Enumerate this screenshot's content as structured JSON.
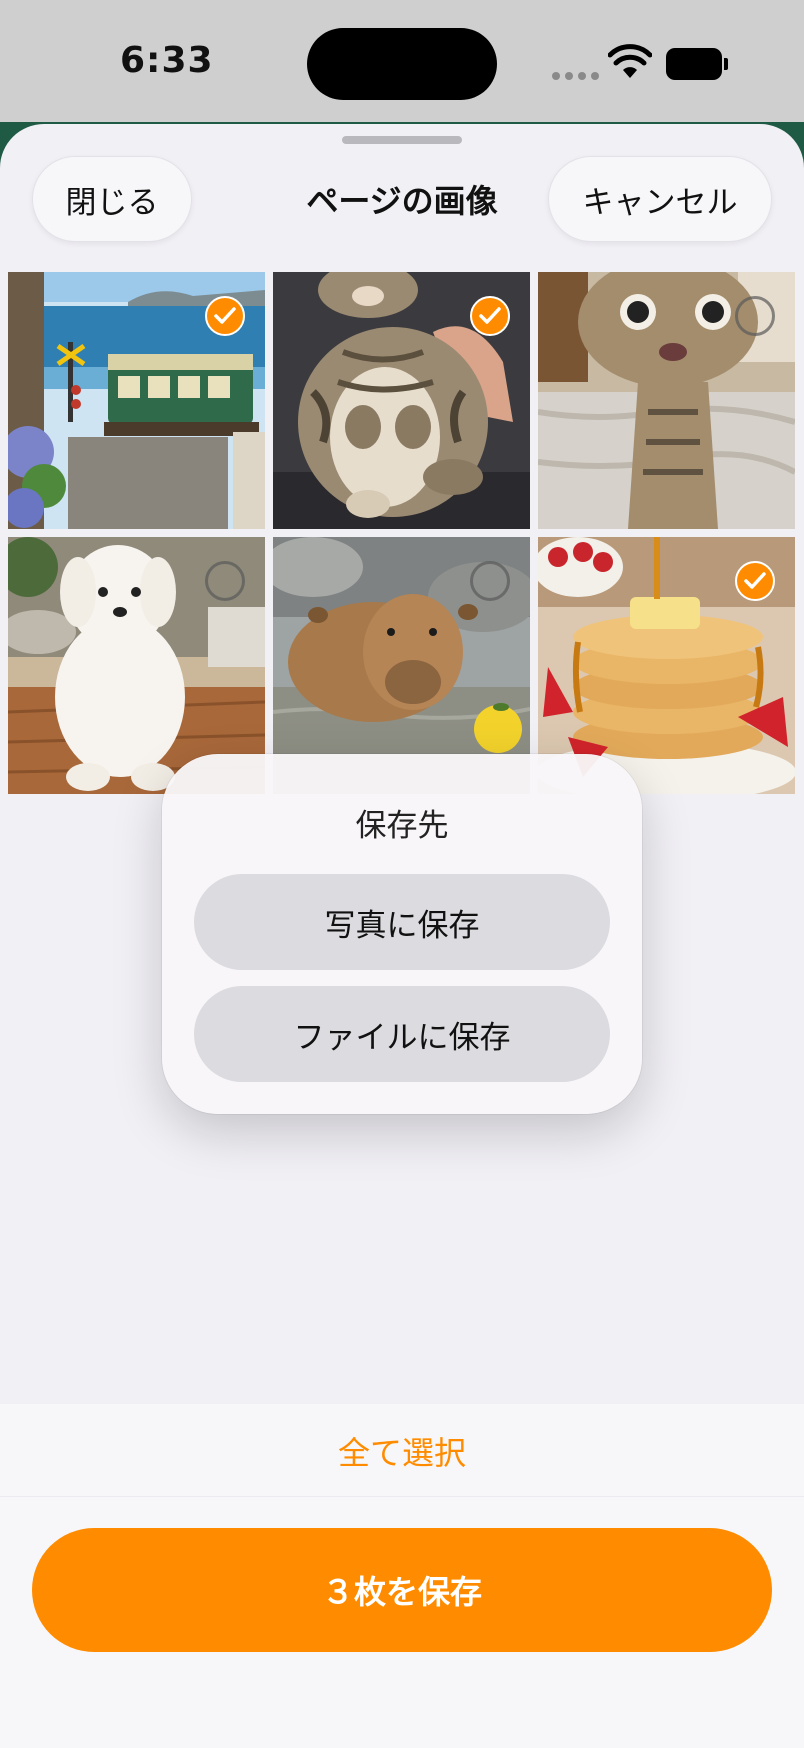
{
  "status_bar": {
    "time": "6:33"
  },
  "header": {
    "title": "ページの画像",
    "close_label": "閉じる",
    "cancel_label": "キャンセル"
  },
  "grid": {
    "images": [
      {
        "subject": "seaside train",
        "selected": true
      },
      {
        "subject": "sitting tabby cat",
        "selected": true
      },
      {
        "subject": "surprised tabby cat",
        "selected": false
      },
      {
        "subject": "white puppy",
        "selected": false
      },
      {
        "subject": "capybara in hot spring",
        "selected": false
      },
      {
        "subject": "pancakes with strawberries",
        "selected": true
      }
    ]
  },
  "popover": {
    "title": "保存先",
    "save_to_photos": "写真に保存",
    "save_to_files": "ファイルに保存"
  },
  "footer": {
    "select_all_label": "全て選択",
    "save_button_label": "３枚を保存"
  },
  "colors": {
    "accent": "#ff8c00",
    "sheet_background": "#f1f0f5",
    "popover_button": "#dcdbe0"
  }
}
